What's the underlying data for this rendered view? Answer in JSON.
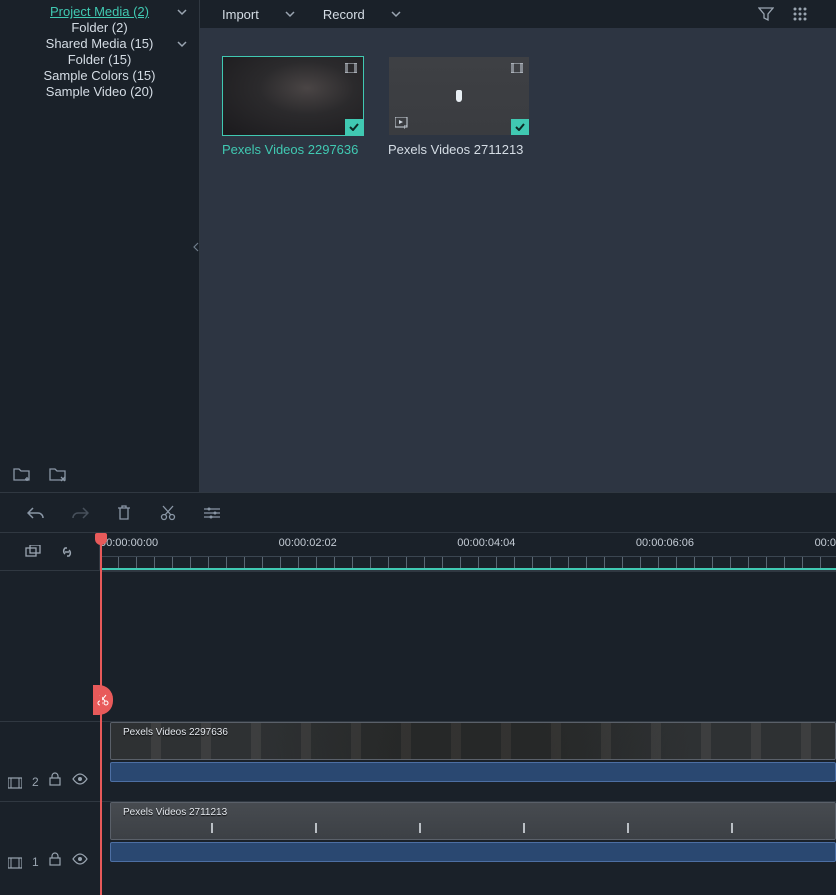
{
  "sidebar": {
    "items": [
      {
        "label": "Project Media (2)",
        "expandable": true,
        "selected": true
      },
      {
        "label": "Folder (2)"
      },
      {
        "label": "Shared Media (15)",
        "expandable": true
      },
      {
        "label": "Folder (15)"
      },
      {
        "label": "Sample Colors (15)"
      },
      {
        "label": "Sample Video (20)"
      }
    ]
  },
  "toolbar": {
    "import_label": "Import",
    "record_label": "Record"
  },
  "thumbs": [
    {
      "label": "Pexels Videos 2297636",
      "selected": true,
      "style": "clouds"
    },
    {
      "label": "Pexels Videos 2711213",
      "selected": false,
      "style": "water"
    }
  ],
  "ruler": {
    "marks": [
      "00:00:00:00",
      "00:00:02:02",
      "00:00:04:04",
      "00:00:06:06",
      "00:0"
    ]
  },
  "tracks": [
    {
      "num": "2",
      "clip_label": "Pexels Videos 2297636",
      "clip_style": "clouds"
    },
    {
      "num": "1",
      "clip_label": "Pexels Videos 2711213",
      "clip_style": "water"
    }
  ]
}
